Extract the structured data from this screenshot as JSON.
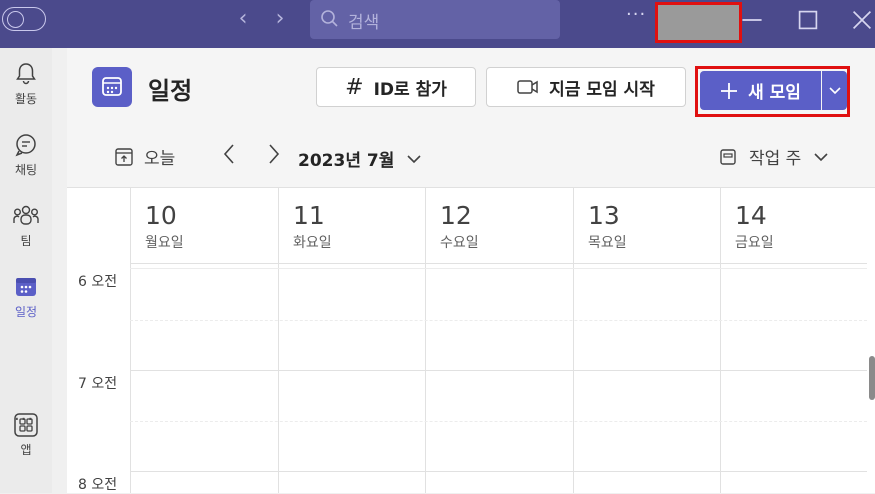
{
  "titlebar": {
    "search_placeholder": "검색"
  },
  "rail": {
    "items": [
      {
        "label": "활동",
        "icon": "bell-icon"
      },
      {
        "label": "채팅",
        "icon": "chat-icon"
      },
      {
        "label": "팀",
        "icon": "teams-icon"
      },
      {
        "label": "일정",
        "icon": "calendar-icon"
      },
      {
        "label": "앱",
        "icon": "apps-icon"
      }
    ],
    "more_label": "···"
  },
  "header": {
    "title": "일정",
    "join_by_id": "ID로 참가",
    "meet_now": "지금 모임 시작",
    "new_meeting": "새 모임"
  },
  "toolbar": {
    "today": "오늘",
    "month": "2023년 7월",
    "view": "작업 주"
  },
  "calendar": {
    "days": [
      {
        "num": "10",
        "name": "월요일"
      },
      {
        "num": "11",
        "name": "화요일"
      },
      {
        "num": "12",
        "name": "수요일"
      },
      {
        "num": "13",
        "name": "목요일"
      },
      {
        "num": "14",
        "name": "금요일"
      }
    ],
    "times": [
      "6 오전",
      "7 오전",
      "8 오전"
    ]
  },
  "colors": {
    "accent": "#5b5fc7",
    "titlebar": "#4b4a8c",
    "highlight": "#e01010"
  }
}
